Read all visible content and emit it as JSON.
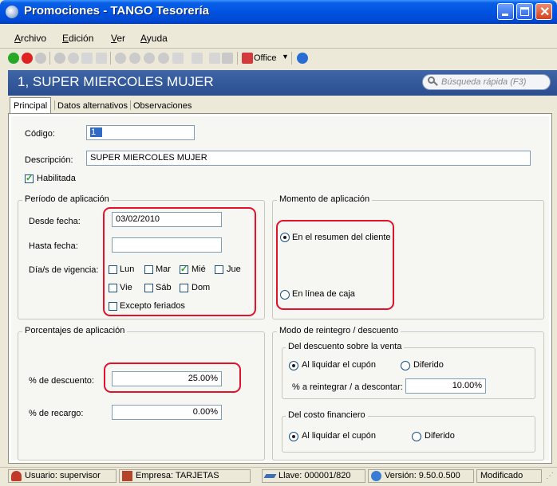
{
  "window": {
    "title": "Promociones - TANGO Tesorería"
  },
  "menu": [
    {
      "label": "Archivo",
      "accel": "A",
      "rest": "rchivo"
    },
    {
      "label": "Edición",
      "accel": "E",
      "rest": "dición"
    },
    {
      "label": "Ver",
      "accel": "V",
      "rest": "er"
    },
    {
      "label": "Ayuda",
      "accel": "A",
      "rest": "yuda"
    }
  ],
  "toolbar": {
    "office_label": "Office"
  },
  "header": {
    "title": "1, SUPER MIERCOLES MUJER",
    "search_placeholder": "Búsqueda rápida (F3)"
  },
  "tabs": [
    "Principal",
    "Datos alternativos",
    "Observaciones"
  ],
  "form": {
    "codigo_label": "Código:",
    "codigo_value": "1",
    "descripcion_label": "Descripción:",
    "descripcion_value": "SUPER MIERCOLES MUJER",
    "habilitada_label": "Habilitada",
    "habilitada_checked": true
  },
  "periodo": {
    "legend": "Período de aplicación",
    "desde_label": "Desde fecha:",
    "desde_value": "03/02/2010",
    "hasta_label": "Hasta fecha:",
    "hasta_value": "",
    "dias_label": "Día/s de vigencia:",
    "dias": [
      {
        "label": "Lun",
        "checked": false
      },
      {
        "label": "Mar",
        "checked": false
      },
      {
        "label": "Mié",
        "checked": true
      },
      {
        "label": "Jue",
        "checked": false
      },
      {
        "label": "Vie",
        "checked": false
      },
      {
        "label": "Sáb",
        "checked": false
      },
      {
        "label": "Dom",
        "checked": false
      }
    ],
    "feriados_label": "Excepto feriados",
    "feriados_checked": false
  },
  "momento": {
    "legend": "Momento de aplicación",
    "opt_resumen": "En el resumen del cliente",
    "opt_caja": "En línea de caja",
    "selected": "resumen"
  },
  "porcentajes": {
    "legend": "Porcentajes de aplicación",
    "descuento_label": "% de descuento:",
    "descuento_value": "25.00%",
    "recargo_label": "% de recargo:",
    "recargo_value": "0.00%"
  },
  "reintegro": {
    "legend": "Modo de reintegro / descuento",
    "venta_legend": "Del descuento sobre la venta",
    "venta_opt1": "Al liquidar el cupón",
    "venta_opt2": "Diferido",
    "reintegrar_label": "% a reintegrar / a descontar:",
    "reintegrar_value": "10.00%",
    "costo_legend": "Del costo financiero",
    "costo_opt1": "Al liquidar el cupón",
    "costo_opt2": "Diferido"
  },
  "status": {
    "usuario": "Usuario: supervisor",
    "empresa": "Empresa: TARJETAS",
    "llave": "Llave: 000001/820",
    "version": "Versión: 9.50.0.500",
    "estado": "Modificado"
  },
  "colors": {
    "titlebar": "#0053e1",
    "header": "#2f559a",
    "highlight": "#e3122a",
    "background": "#ece9d8"
  }
}
